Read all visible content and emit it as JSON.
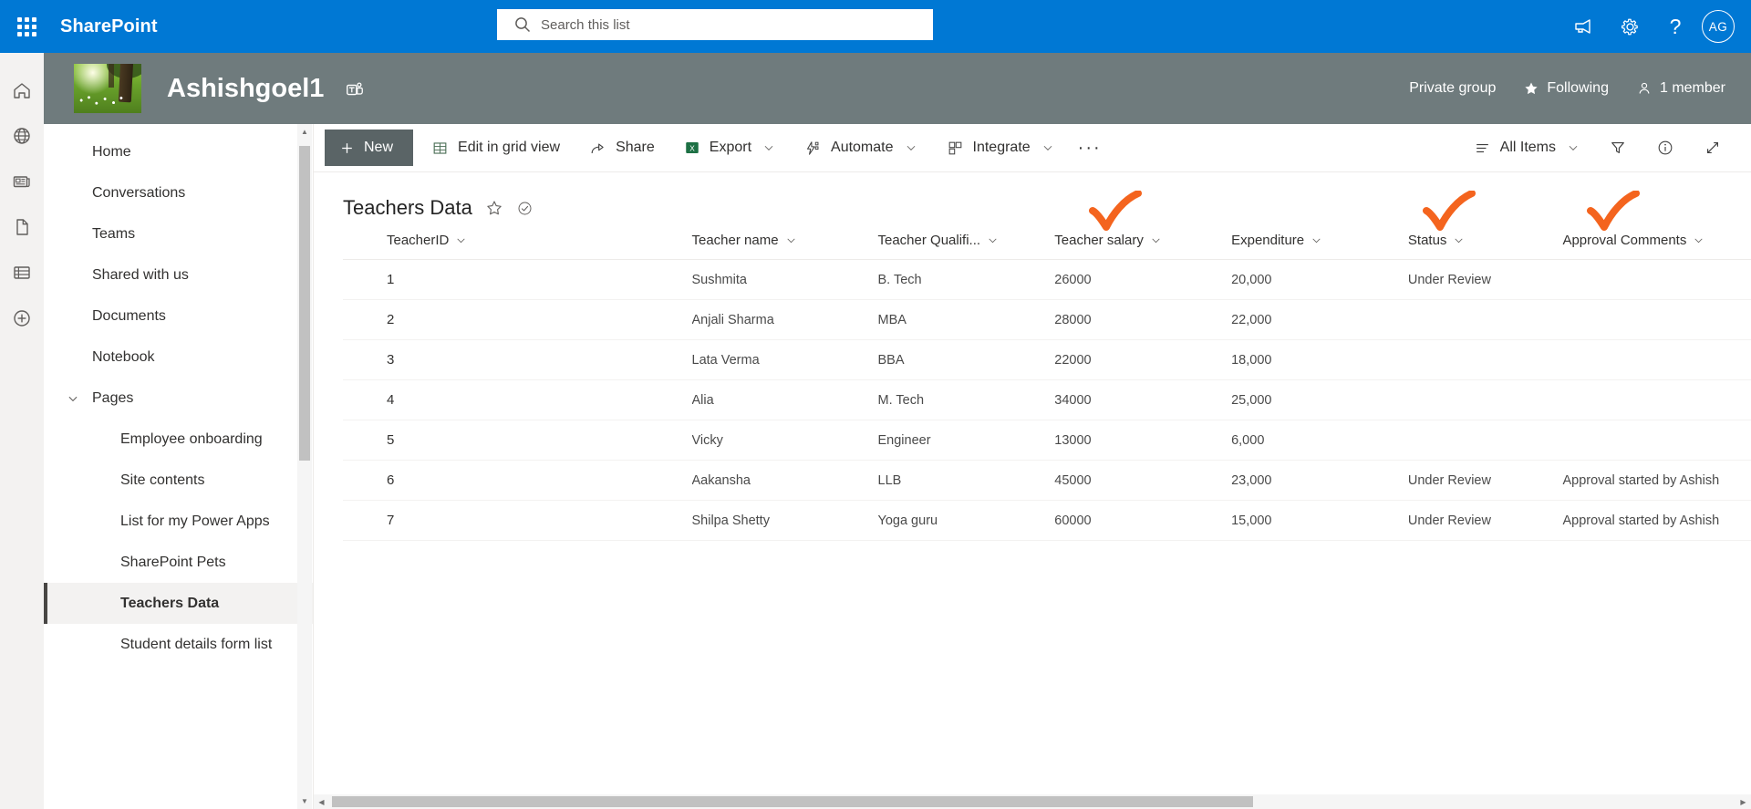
{
  "suite_bar": {
    "waffle_label": "app-launcher",
    "brand": "SharePoint",
    "search_placeholder": "Search this list",
    "search_value": "",
    "icons": [
      "megaphone-icon",
      "gear-icon",
      "help-icon"
    ],
    "avatar_initials": "AG",
    "background_color": "#0078d4"
  },
  "app_rail": {
    "items": [
      {
        "name": "home-icon"
      },
      {
        "name": "globe-icon"
      },
      {
        "name": "news-icon"
      },
      {
        "name": "file-icon"
      },
      {
        "name": "lists-icon"
      },
      {
        "name": "create-icon"
      }
    ]
  },
  "site_header": {
    "title": "Ashishgoel1",
    "teams_badge": "teams-icon",
    "privacy": "Private group",
    "following": "Following",
    "members": "1 member",
    "background_color": "#6f7b7d"
  },
  "left_nav": {
    "items": [
      {
        "label": "Home",
        "level": 0,
        "selected": false,
        "expandable": false
      },
      {
        "label": "Conversations",
        "level": 0,
        "selected": false,
        "expandable": false
      },
      {
        "label": "Teams",
        "level": 0,
        "selected": false,
        "expandable": false
      },
      {
        "label": "Shared with us",
        "level": 0,
        "selected": false,
        "expandable": false
      },
      {
        "label": "Documents",
        "level": 0,
        "selected": false,
        "expandable": false
      },
      {
        "label": "Notebook",
        "level": 0,
        "selected": false,
        "expandable": false
      },
      {
        "label": "Pages",
        "level": 0,
        "selected": false,
        "expandable": true
      },
      {
        "label": "Employee onboarding",
        "level": 1,
        "selected": false,
        "expandable": false
      },
      {
        "label": "Site contents",
        "level": 1,
        "selected": false,
        "expandable": false
      },
      {
        "label": "List for my Power Apps",
        "level": 1,
        "selected": false,
        "expandable": false
      },
      {
        "label": "SharePoint Pets",
        "level": 1,
        "selected": false,
        "expandable": false
      },
      {
        "label": "Teachers Data",
        "level": 1,
        "selected": true,
        "expandable": false
      },
      {
        "label": "Student details form list",
        "level": 1,
        "selected": false,
        "expandable": false
      }
    ]
  },
  "command_bar": {
    "new_label": "New",
    "buttons": [
      {
        "label": "Edit in grid view",
        "icon": "grid-icon",
        "chevron": false
      },
      {
        "label": "Share",
        "icon": "share-icon",
        "chevron": false
      },
      {
        "label": "Export",
        "icon": "excel-icon",
        "chevron": true
      },
      {
        "label": "Automate",
        "icon": "automate-icon",
        "chevron": true
      },
      {
        "label": "Integrate",
        "icon": "integrate-icon",
        "chevron": true
      }
    ],
    "overflow_label": "···",
    "view_label": "All Items",
    "right_icons": [
      "filter-icon",
      "info-icon",
      "expand-icon"
    ]
  },
  "list": {
    "title": "Teachers Data",
    "favorite_icon": "star-icon",
    "status_icon": "check-circle-icon",
    "columns": [
      {
        "key": "id",
        "label": "TeacherID",
        "checkmark": false
      },
      {
        "key": "name",
        "label": "Teacher name",
        "checkmark": true
      },
      {
        "key": "qualification",
        "label": "Teacher Qualifi...",
        "checkmark": false
      },
      {
        "key": "salary",
        "label": "Teacher salary",
        "checkmark": true
      },
      {
        "key": "expenditure",
        "label": "Expenditure",
        "checkmark": true
      },
      {
        "key": "status",
        "label": "Status",
        "checkmark": false
      },
      {
        "key": "approval",
        "label": "Approval Comments",
        "checkmark": false
      }
    ],
    "rows": [
      {
        "id": "1",
        "name": "Sushmita",
        "qualification": "B. Tech",
        "salary": "26000",
        "expenditure": "20,000",
        "status": "Under Review",
        "approval": ""
      },
      {
        "id": "2",
        "name": "Anjali Sharma",
        "qualification": "MBA",
        "salary": "28000",
        "expenditure": "22,000",
        "status": "",
        "approval": ""
      },
      {
        "id": "3",
        "name": "Lata Verma",
        "qualification": "BBA",
        "salary": "22000",
        "expenditure": "18,000",
        "status": "",
        "approval": ""
      },
      {
        "id": "4",
        "name": "Alia",
        "qualification": "M. Tech",
        "salary": "34000",
        "expenditure": "25,000",
        "status": "",
        "approval": ""
      },
      {
        "id": "5",
        "name": "Vicky",
        "qualification": "Engineer",
        "salary": "13000",
        "expenditure": "6,000",
        "status": "",
        "approval": ""
      },
      {
        "id": "6",
        "name": "Aakansha",
        "qualification": "LLB",
        "salary": "45000",
        "expenditure": "23,000",
        "status": "Under Review",
        "approval": "Approval started by Ashish"
      },
      {
        "id": "7",
        "name": "Shilpa Shetty",
        "qualification": "Yoga guru",
        "salary": "60000",
        "expenditure": "15,000",
        "status": "Under Review",
        "approval": "Approval started by Ashish"
      }
    ]
  },
  "annotations": {
    "color": "#f4641e",
    "marks": [
      "checkmark-teacher-name",
      "checkmark-teacher-salary",
      "checkmark-expenditure"
    ]
  }
}
